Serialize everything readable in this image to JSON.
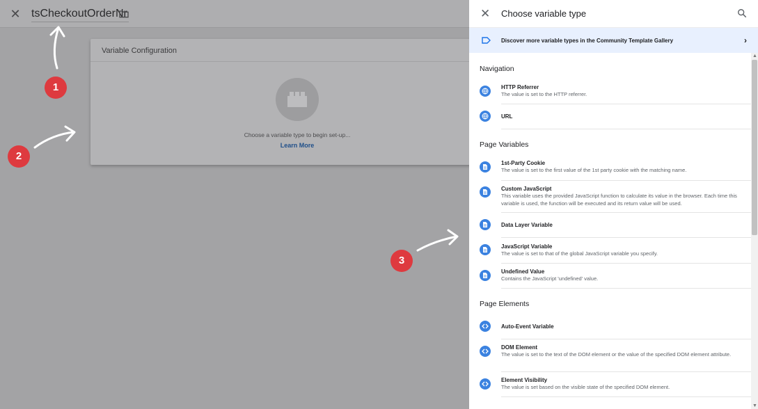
{
  "editor": {
    "variable_name": "tsCheckoutOrderNr",
    "card_title": "Variable Configuration",
    "choose_hint": "Choose a variable type to begin set-up...",
    "learn_more": "Learn More"
  },
  "annotations": {
    "badge1": "1",
    "badge2": "2",
    "badge3": "3"
  },
  "panel": {
    "title": "Choose variable type",
    "gallery_text": "Discover more variable types in the Community Template Gallery",
    "sections": [
      {
        "title": "Navigation",
        "items": [
          {
            "title": "HTTP Referrer",
            "desc": "The value is set to the HTTP referrer.",
            "icon": "globe-icon"
          },
          {
            "title": "URL",
            "desc": "",
            "icon": "globe-icon"
          }
        ]
      },
      {
        "title": "Page Variables",
        "items": [
          {
            "title": "1st-Party Cookie",
            "desc": "The value is set to the first value of the 1st party cookie with the matching name.",
            "icon": "document-icon"
          },
          {
            "title": "Custom JavaScript",
            "desc": "This variable uses the provided JavaScript function to calculate its value in the browser. Each time this variable is used, the function will be executed and its return value will be used.",
            "icon": "document-icon"
          },
          {
            "title": "Data Layer Variable",
            "desc": "",
            "icon": "document-icon"
          },
          {
            "title": "JavaScript Variable",
            "desc": "The value is set to that of the global JavaScript variable you specify.",
            "icon": "document-icon"
          },
          {
            "title": "Undefined Value",
            "desc": "Contains the JavaScript 'undefined' value.",
            "icon": "document-icon"
          }
        ]
      },
      {
        "title": "Page Elements",
        "items": [
          {
            "title": "Auto-Event Variable",
            "desc": "",
            "icon": "code-icon"
          },
          {
            "title": "DOM Element",
            "desc": "The value is set to the text of the DOM element or the value of the specified DOM element attribute.",
            "icon": "code-icon"
          },
          {
            "title": "Element Visibility",
            "desc": "The value is set based on the visible state of the specified DOM element.",
            "icon": "code-icon"
          }
        ]
      }
    ]
  },
  "colors": {
    "accent": "#3b82e0",
    "badge": "#de3a3f",
    "gallery_bg": "#e8f0fe"
  }
}
